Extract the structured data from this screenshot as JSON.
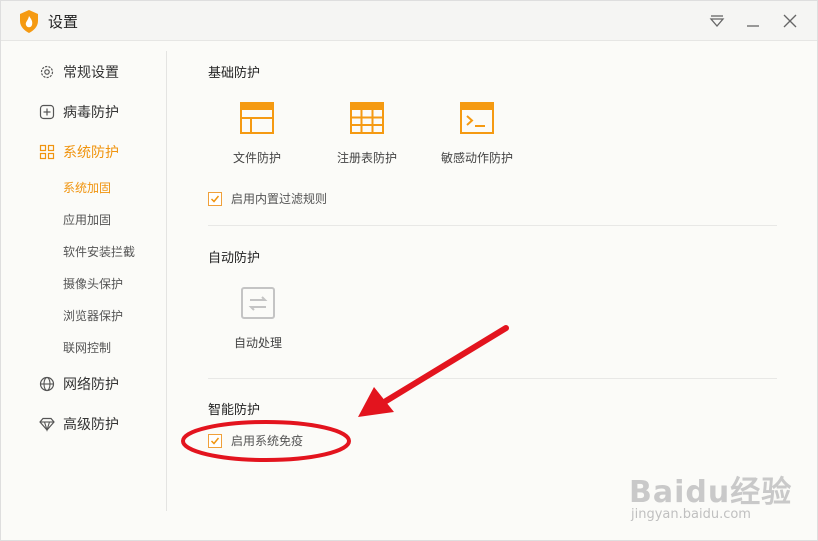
{
  "window": {
    "title": "设置"
  },
  "colors": {
    "accent": "#f0940f",
    "annotation": "#e3141e"
  },
  "icons": {
    "app": "flame-shield-icon",
    "menu": "triangle-menu-icon",
    "minimize": "minimize-icon",
    "close": "close-icon"
  },
  "sidebar": {
    "items": [
      {
        "label": "常规设置",
        "icon": "gear-icon"
      },
      {
        "label": "病毒防护",
        "icon": "plus-square-icon"
      },
      {
        "label": "系统防护",
        "icon": "grid-icon",
        "active": true
      },
      {
        "label": "网络防护",
        "icon": "globe-icon"
      },
      {
        "label": "高级防护",
        "icon": "diamond-icon"
      }
    ],
    "subitems": [
      {
        "label": "系统加固",
        "active": true
      },
      {
        "label": "应用加固"
      },
      {
        "label": "软件安装拦截"
      },
      {
        "label": "摄像头保护"
      },
      {
        "label": "浏览器保护"
      },
      {
        "label": "联网控制"
      }
    ]
  },
  "basic_protection": {
    "title": "基础防护",
    "features": [
      {
        "label": "文件防护",
        "icon": "file-window-icon"
      },
      {
        "label": "注册表防护",
        "icon": "registry-grid-icon"
      },
      {
        "label": "敏感动作防护",
        "icon": "terminal-icon"
      }
    ],
    "checkbox": {
      "label": "启用内置过滤规则",
      "checked": true
    }
  },
  "auto_protection": {
    "title": "自动防护",
    "feature": {
      "label": "自动处理",
      "icon": "auto-swap-icon"
    }
  },
  "smart_protection": {
    "title": "智能防护",
    "checkbox": {
      "label": "启用系统免疫",
      "checked": true
    }
  },
  "watermark": {
    "logo": "Baidu经验",
    "url": "jingyan.baidu.com"
  }
}
